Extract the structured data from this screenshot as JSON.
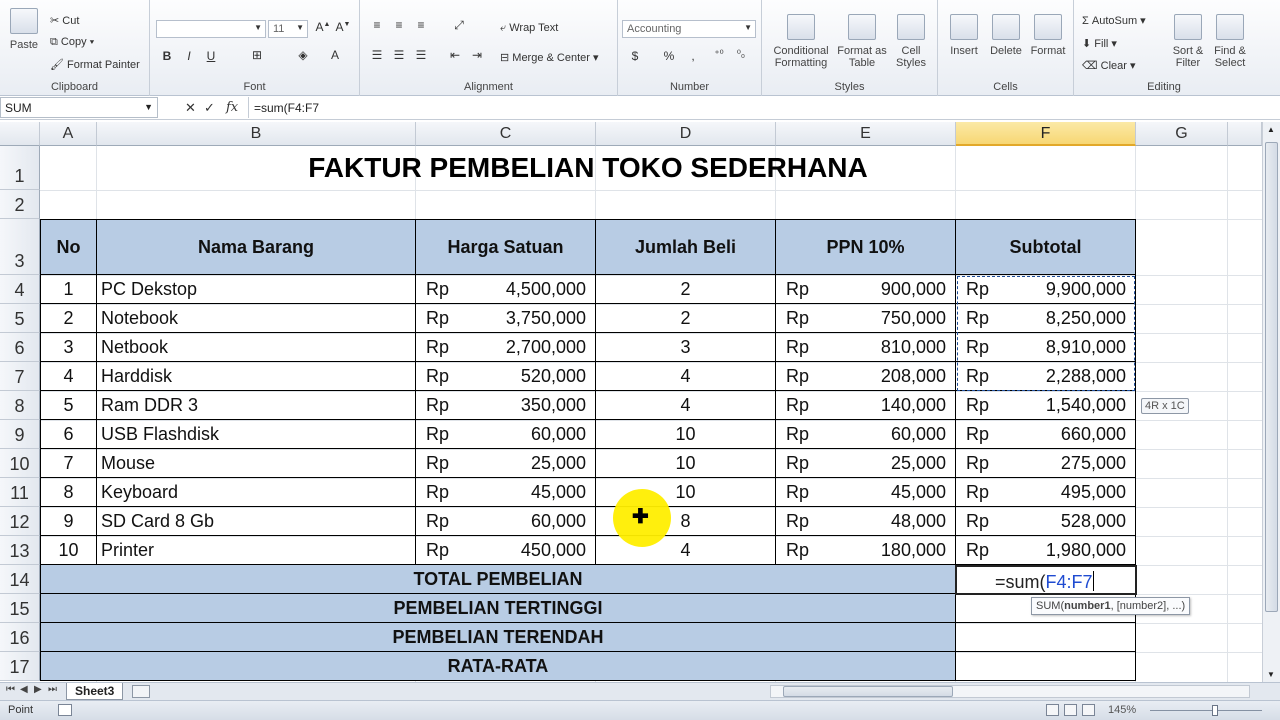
{
  "ribbon": {
    "clipboard": {
      "paste": "Paste",
      "cut": "Cut",
      "copy": "Copy",
      "format_painter": "Format Painter",
      "label": "Clipboard"
    },
    "font": {
      "size": "11",
      "label": "Font"
    },
    "alignment": {
      "wrap_text": "Wrap Text",
      "merge_center": "Merge & Center",
      "label": "Alignment"
    },
    "number": {
      "format": "Accounting",
      "currency": "$",
      "percent": "%",
      "comma": ",",
      "label": "Number"
    },
    "styles": {
      "conditional": "Conditional Formatting",
      "format_table": "Format as Table",
      "cell_styles": "Cell Styles",
      "label": "Styles"
    },
    "cells": {
      "insert": "Insert",
      "delete": "Delete",
      "format": "Format",
      "label": "Cells"
    },
    "editing": {
      "autosum": "AutoSum",
      "fill": "Fill",
      "clear": "Clear",
      "sort_filter": "Sort & Filter",
      "find_select": "Find & Select",
      "label": "Editing"
    }
  },
  "formula_bar": {
    "name_box": "SUM",
    "formula": "=sum(F4:F7"
  },
  "columns": [
    "A",
    "B",
    "C",
    "D",
    "E",
    "F",
    "G"
  ],
  "rows": [
    "1",
    "2",
    "3",
    "4",
    "5",
    "6",
    "7",
    "8",
    "9",
    "10",
    "11",
    "12",
    "13",
    "14",
    "15",
    "16",
    "17"
  ],
  "sheet": {
    "title": "FAKTUR PEMBELIAN TOKO SEDERHANA",
    "headers": {
      "no": "No",
      "nama": "Nama Barang",
      "harga": "Harga Satuan",
      "jumlah": "Jumlah Beli",
      "ppn": "PPN 10%",
      "subtotal": "Subtotal"
    },
    "currency": "Rp",
    "items": [
      {
        "no": "1",
        "nama": "PC Dekstop",
        "harga": "4,500,000",
        "jumlah": "2",
        "ppn": "900,000",
        "subtotal": "9,900,000"
      },
      {
        "no": "2",
        "nama": "Notebook",
        "harga": "3,750,000",
        "jumlah": "2",
        "ppn": "750,000",
        "subtotal": "8,250,000"
      },
      {
        "no": "3",
        "nama": "Netbook",
        "harga": "2,700,000",
        "jumlah": "3",
        "ppn": "810,000",
        "subtotal": "8,910,000"
      },
      {
        "no": "4",
        "nama": "Harddisk",
        "harga": "520,000",
        "jumlah": "4",
        "ppn": "208,000",
        "subtotal": "2,288,000"
      },
      {
        "no": "5",
        "nama": "Ram DDR 3",
        "harga": "350,000",
        "jumlah": "4",
        "ppn": "140,000",
        "subtotal": "1,540,000"
      },
      {
        "no": "6",
        "nama": "USB Flashdisk",
        "harga": "60,000",
        "jumlah": "10",
        "ppn": "60,000",
        "subtotal": "660,000"
      },
      {
        "no": "7",
        "nama": "Mouse",
        "harga": "25,000",
        "jumlah": "10",
        "ppn": "25,000",
        "subtotal": "275,000"
      },
      {
        "no": "8",
        "nama": "Keyboard",
        "harga": "45,000",
        "jumlah": "10",
        "ppn": "45,000",
        "subtotal": "495,000"
      },
      {
        "no": "9",
        "nama": "SD Card 8 Gb",
        "harga": "60,000",
        "jumlah": "8",
        "ppn": "48,000",
        "subtotal": "528,000"
      },
      {
        "no": "10",
        "nama": "Printer",
        "harga": "450,000",
        "jumlah": "4",
        "ppn": "180,000",
        "subtotal": "1,980,000"
      }
    ],
    "summary": [
      "TOTAL PEMBELIAN",
      "PEMBELIAN TERTINGGI",
      "PEMBELIAN TERENDAH",
      "RATA-RATA"
    ],
    "edit_prefix": "=sum(",
    "edit_ref": "F4:F7"
  },
  "tooltips": {
    "range_size": "4R x 1C",
    "function_hint_prefix": "SUM(",
    "function_hint_bold": "number1",
    "function_hint_rest": ", [number2], ...)"
  },
  "tabs": {
    "sheet": "Sheet3"
  },
  "status": {
    "mode": "Point",
    "zoom": "145%"
  }
}
